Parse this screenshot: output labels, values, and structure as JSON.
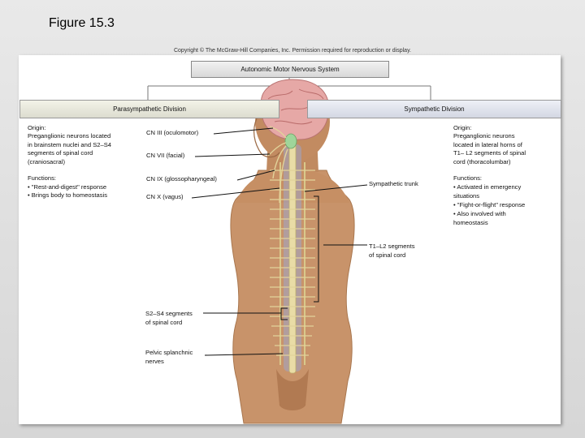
{
  "slide_title": "Figure 15.3",
  "copyright": "Copyright © The McGraw-Hill Companies, Inc. Permission required for reproduction or display.",
  "root": "Autonomic Motor Nervous System",
  "parasympathetic": {
    "title": "Parasympathetic Division",
    "origin_label": "Origin:",
    "origin_text": "Preganglionic neurons located\nin brainstem nuclei and S2–S4\nsegments of spinal cord\n(craniosacral)",
    "functions_label": "Functions:",
    "functions_items": [
      "• \"Rest-and-digest\" response",
      "• Brings body to homeostasis"
    ]
  },
  "sympathetic": {
    "title": "Sympathetic Division",
    "origin_label": "Origin:",
    "origin_text": "Preganglionic neurons\nlocated in lateral horns of\nT1– L2 segments of spinal\ncord (thoracolumbar)",
    "functions_label": "Functions:",
    "functions_items": [
      "• Activated in emergency\n  situations",
      "• \"Fight-or-flight\" response",
      "• Also involved with\n  homeostasis"
    ]
  },
  "labels": {
    "cn3": "CN III (oculomotor)",
    "cn7": "CN VII (facial)",
    "cn9": "CN IX (glossopharyngeal)",
    "cn10": "CN X (vagus)",
    "symp_trunk": "Sympathetic trunk",
    "t1l2": "T1–L2 segments\nof spinal cord",
    "s2s4": "S2–S4 segments\nof spinal cord",
    "pelvic": "Pelvic splanchnic\nnerves"
  },
  "colors": {
    "skin": "#c8936a",
    "nerve": "#e9dca6",
    "brain": "#e6a8a6",
    "bracket": "#111111"
  }
}
